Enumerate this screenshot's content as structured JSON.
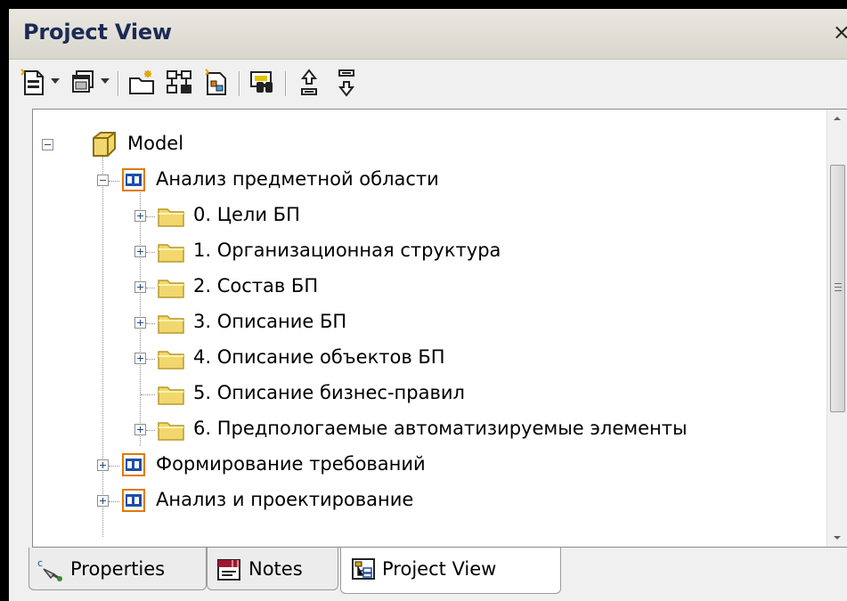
{
  "window": {
    "title": "Project View",
    "close_glyph": "×"
  },
  "toolbar": {
    "buttons": [
      {
        "icon": "new-element-icon",
        "has_dropdown": true
      },
      {
        "icon": "diagram-stack-icon",
        "has_dropdown": true
      },
      {
        "icon": "new-package-icon",
        "has_dropdown": false
      },
      {
        "icon": "tree-structure-icon",
        "has_dropdown": false
      },
      {
        "icon": "new-diagram-icon",
        "has_dropdown": false
      },
      {
        "icon": "find-binoculars-icon",
        "has_dropdown": false
      },
      {
        "icon": "move-up-icon",
        "has_dropdown": false
      },
      {
        "icon": "move-down-icon",
        "has_dropdown": false
      }
    ]
  },
  "tree": {
    "root": {
      "label": "Model",
      "icon": "model-root-icon",
      "expanded": true
    },
    "view_analysis": {
      "label": "Анализ предметной области",
      "icon": "view-icon",
      "expanded": true
    },
    "packages": [
      {
        "label": "0. Цели БП",
        "expandable": true
      },
      {
        "label": "1. Организационная структура",
        "expandable": true
      },
      {
        "label": "2. Состав БП",
        "expandable": true
      },
      {
        "label": "3. Описание БП",
        "expandable": true
      },
      {
        "label": "4. Описание объектов БП",
        "expandable": true
      },
      {
        "label": "5. Описание бизнес-правил",
        "expandable": false
      },
      {
        "label": "6. Предпологаемые автоматизируемые элементы",
        "expandable": true
      }
    ],
    "view_requirements": {
      "label": "Формирование требований",
      "icon": "view-icon",
      "expanded": false
    },
    "view_design": {
      "label": "Анализ и проектирование",
      "icon": "view-icon",
      "expanded": false
    }
  },
  "tabs": [
    {
      "label": "Properties",
      "icon": "properties-icon",
      "active": false
    },
    {
      "label": "Notes",
      "icon": "notes-icon",
      "active": false
    },
    {
      "label": "Project View",
      "icon": "project-view-icon",
      "active": true
    }
  ],
  "colors": {
    "title_text": "#1b2a55",
    "folder": "#f2d76e",
    "view_icon": "#1e4fa8"
  }
}
